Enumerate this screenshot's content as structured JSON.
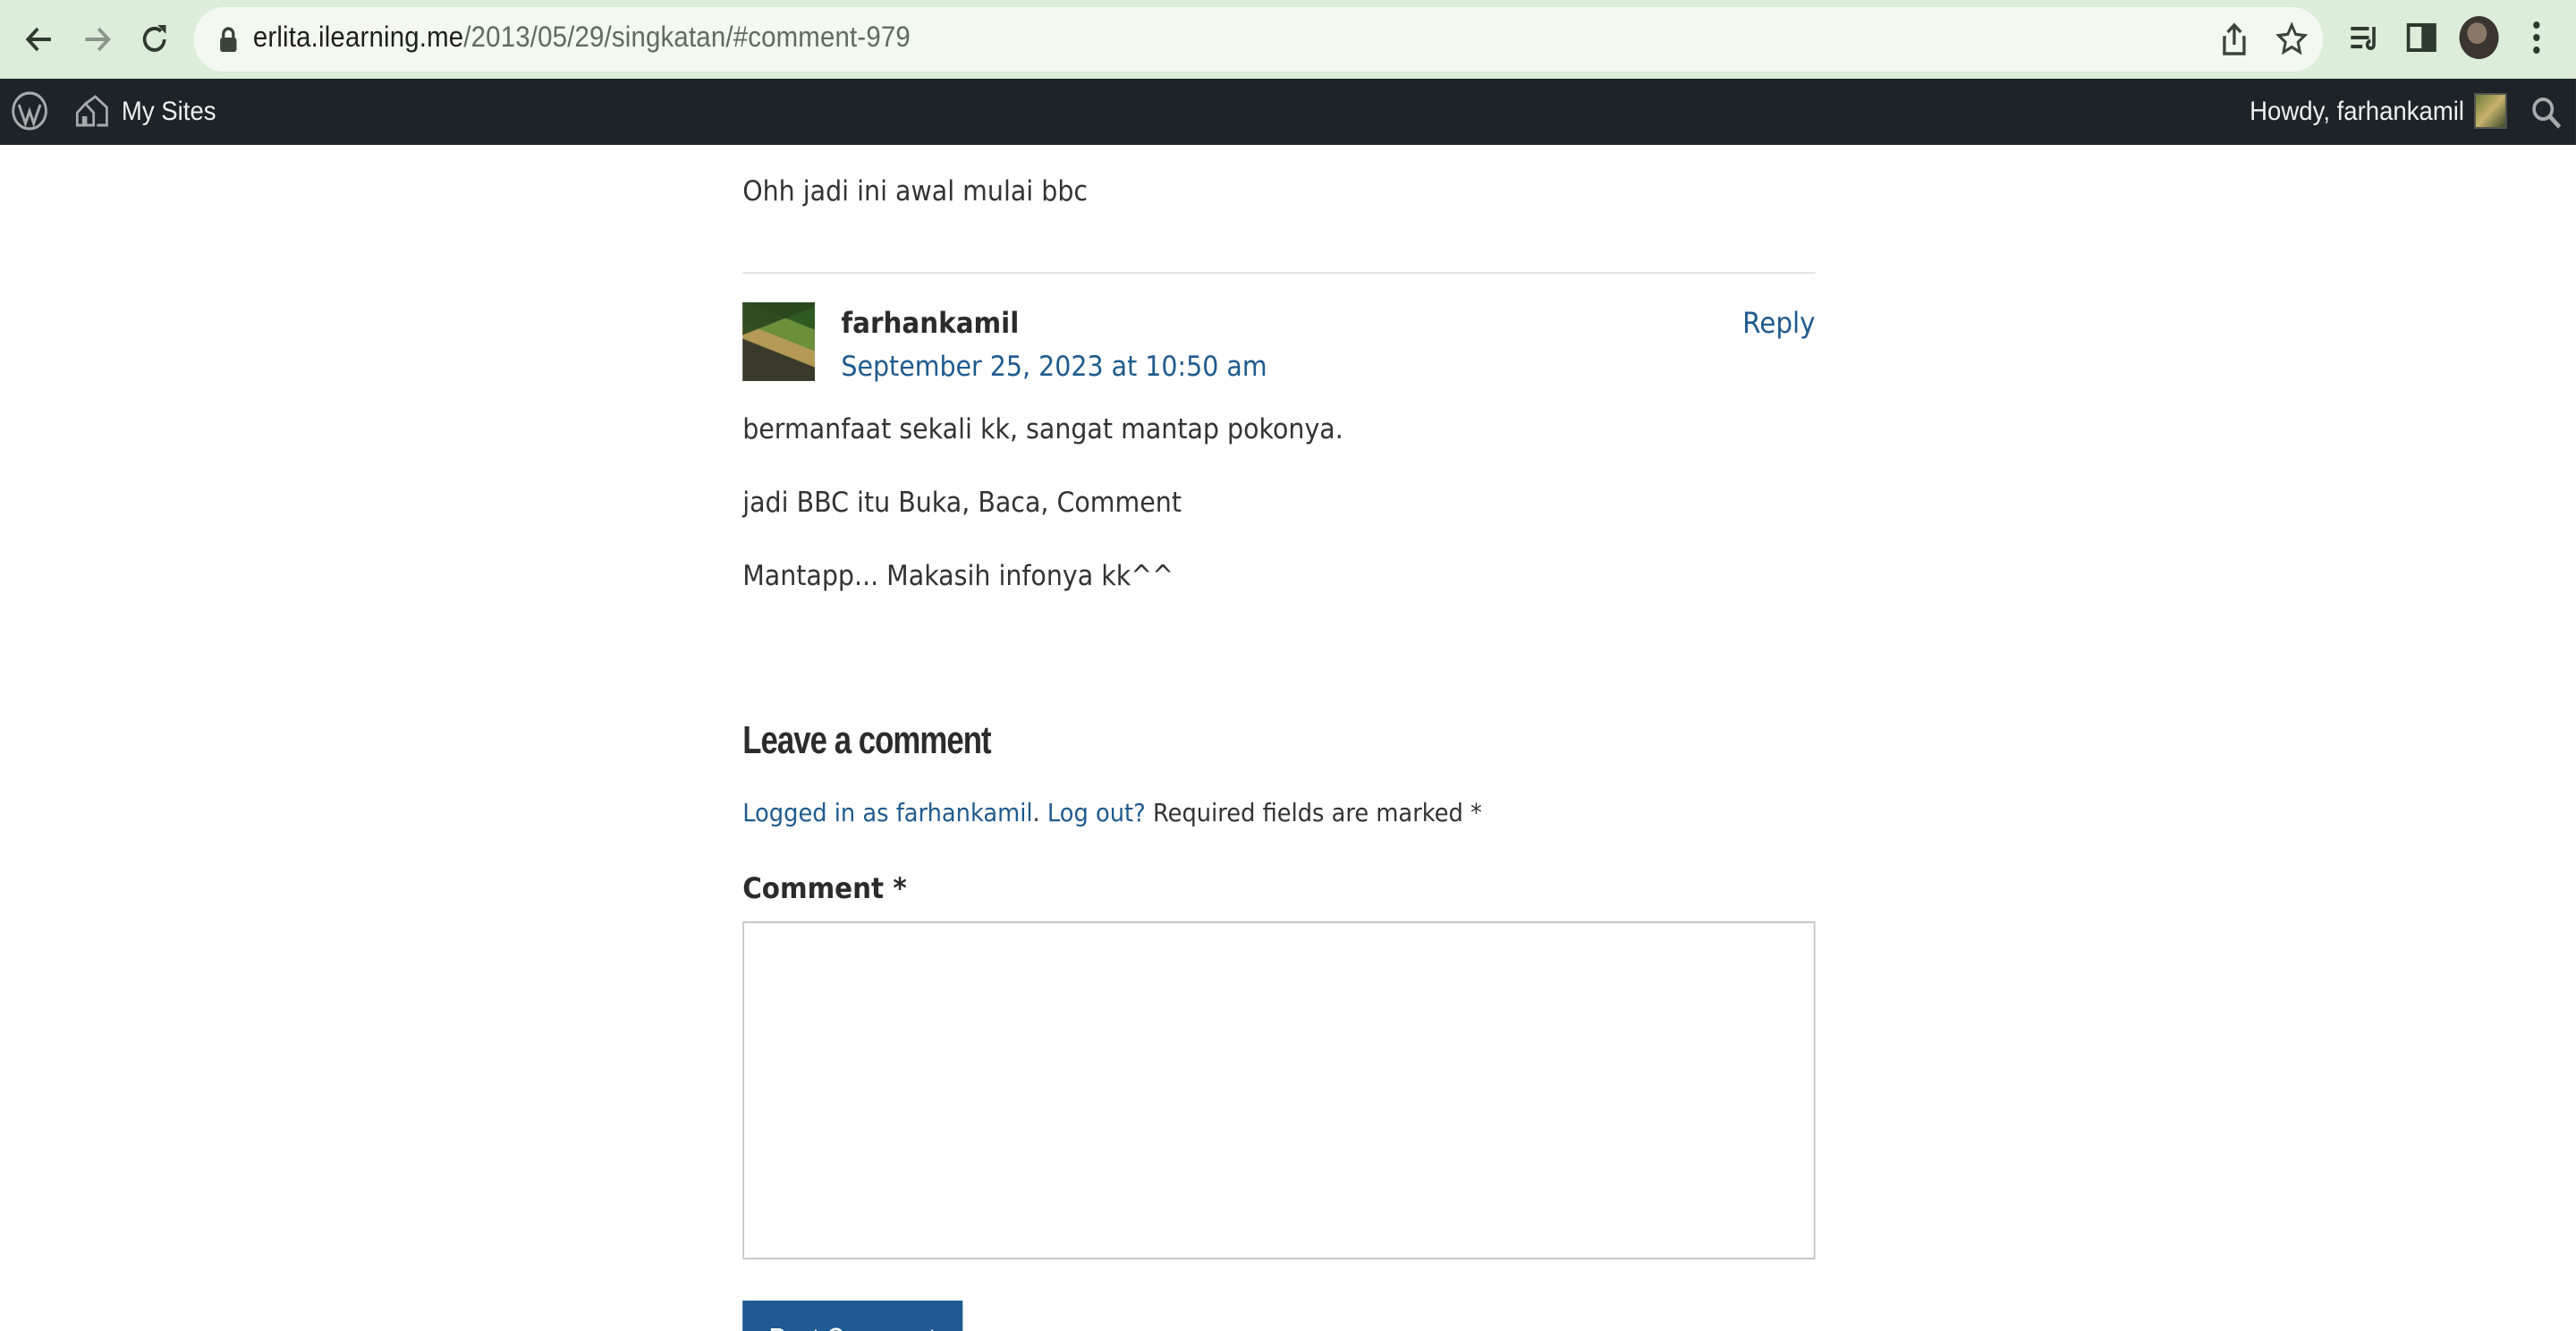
{
  "browser": {
    "url_host": "erlita.ilearning.me",
    "url_path": "/2013/05/29/singkatan/#comment-979",
    "icons": [
      "back-icon",
      "forward-icon",
      "reload-icon",
      "lock-icon",
      "share-icon",
      "star-icon",
      "reading-list-icon",
      "side-panel-icon",
      "profile-avatar",
      "more-menu-icon"
    ]
  },
  "admin_bar": {
    "my_sites_label": "My Sites",
    "howdy_label": "Howdy, farhankamil"
  },
  "comments": {
    "previous_comment_text": "Ohh jadi ini awal mulai bbc",
    "comment": {
      "author": "farhankamil",
      "date": "September 25, 2023 at 10:50 am",
      "reply_label": "Reply",
      "paragraphs": [
        "bermanfaat sekali kk, sangat mantap pokonya.",
        "jadi BBC itu Buka, Baca, Comment",
        "Mantapp... Makasih infonya kk^^"
      ]
    }
  },
  "comment_form": {
    "title": "Leave a comment",
    "logged_in_link": "Logged in as farhankamil",
    "logout_link": "Log out?",
    "required_note": " Required fields are marked *",
    "comment_label": "Comment *",
    "comment_value": "",
    "submit_label": "Post Comment"
  },
  "colors": {
    "chrome_bg": "#dcedd9",
    "admin_bar_bg": "#1d2327",
    "link": "#1e5a8e",
    "button_bg": "#1f5a92"
  }
}
